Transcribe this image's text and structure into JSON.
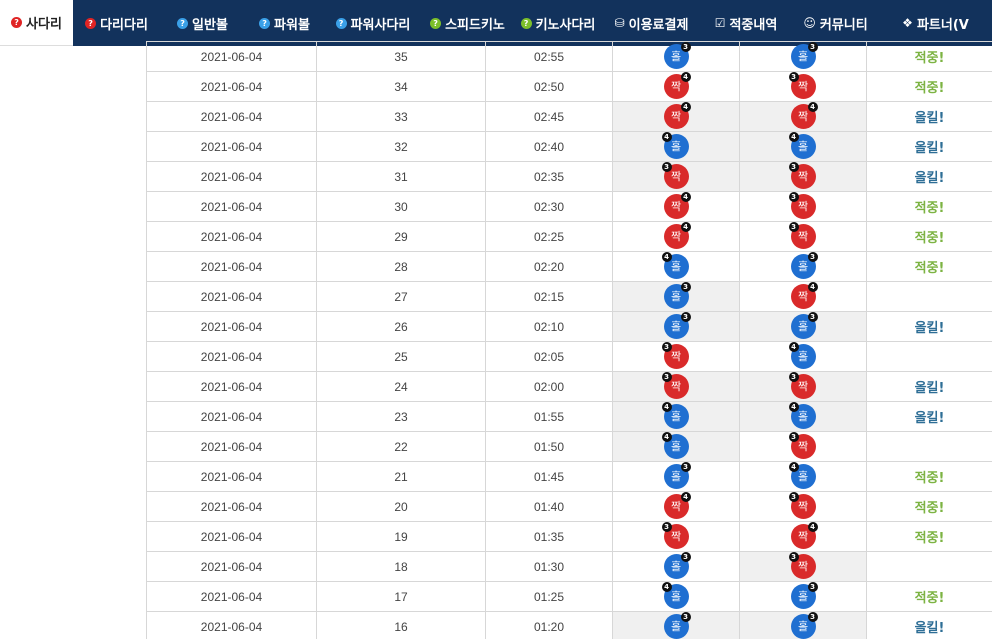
{
  "nav": {
    "tabs": [
      {
        "label": "사다리",
        "icon": "question-icon",
        "icon_color": "red",
        "active": true
      },
      {
        "label": "다리다리",
        "icon": "question-icon",
        "icon_color": "red",
        "active": false
      },
      {
        "label": "일반볼",
        "icon": "question-icon",
        "icon_color": "blue",
        "active": false
      },
      {
        "label": "파워볼",
        "icon": "question-icon",
        "icon_color": "blue",
        "active": false
      },
      {
        "label": "파워사다리",
        "icon": "question-icon",
        "icon_color": "blue",
        "active": false
      },
      {
        "label": "스피드키노",
        "icon": "question-icon",
        "icon_color": "green",
        "active": false
      },
      {
        "label": "키노사다리",
        "icon": "question-icon",
        "icon_color": "green",
        "active": false
      },
      {
        "label": "이용료결제",
        "icon": "database-icon",
        "icon_color": "white",
        "active": false
      },
      {
        "label": "적중내역",
        "icon": "checkbox-icon",
        "icon_color": "white",
        "active": false
      },
      {
        "label": "커뮤니티",
        "icon": "smile-icon",
        "icon_color": "white",
        "active": false
      },
      {
        "label": "파트너(V",
        "icon": "cubes-icon",
        "icon_color": "white",
        "active": false
      }
    ],
    "colors": {
      "bar": "#12325c",
      "active_bg": "#ffffff"
    }
  },
  "results": {
    "labels": {
      "hit": "적중!",
      "allkill": "올킬!"
    },
    "ball_colors": {
      "odd": "#1f6fd1",
      "even": "#d92a2a"
    },
    "rows": [
      {
        "date": "2021-06-04",
        "round": "35",
        "time": "02:55",
        "pick1": {
          "text": "홀",
          "type": "odd",
          "badge": "3",
          "side": "right"
        },
        "pick1_shade": false,
        "pick2": {
          "text": "홀",
          "type": "odd",
          "badge": "3",
          "side": "right"
        },
        "pick2_shade": false,
        "result": "적중!",
        "result_type": "hit"
      },
      {
        "date": "2021-06-04",
        "round": "34",
        "time": "02:50",
        "pick1": {
          "text": "짝",
          "type": "even",
          "badge": "4",
          "side": "right"
        },
        "pick1_shade": false,
        "pick2": {
          "text": "짝",
          "type": "even",
          "badge": "3",
          "side": "left"
        },
        "pick2_shade": false,
        "result": "적중!",
        "result_type": "hit"
      },
      {
        "date": "2021-06-04",
        "round": "33",
        "time": "02:45",
        "pick1": {
          "text": "짝",
          "type": "even",
          "badge": "4",
          "side": "right"
        },
        "pick1_shade": true,
        "pick2": {
          "text": "짝",
          "type": "even",
          "badge": "4",
          "side": "right"
        },
        "pick2_shade": true,
        "result": "올킬!",
        "result_type": "allkill"
      },
      {
        "date": "2021-06-04",
        "round": "32",
        "time": "02:40",
        "pick1": {
          "text": "홀",
          "type": "odd",
          "badge": "4",
          "side": "left"
        },
        "pick1_shade": true,
        "pick2": {
          "text": "홀",
          "type": "odd",
          "badge": "4",
          "side": "left"
        },
        "pick2_shade": true,
        "result": "올킬!",
        "result_type": "allkill"
      },
      {
        "date": "2021-06-04",
        "round": "31",
        "time": "02:35",
        "pick1": {
          "text": "짝",
          "type": "even",
          "badge": "3",
          "side": "left"
        },
        "pick1_shade": true,
        "pick2": {
          "text": "짝",
          "type": "even",
          "badge": "3",
          "side": "left"
        },
        "pick2_shade": true,
        "result": "올킬!",
        "result_type": "allkill"
      },
      {
        "date": "2021-06-04",
        "round": "30",
        "time": "02:30",
        "pick1": {
          "text": "짝",
          "type": "even",
          "badge": "4",
          "side": "right"
        },
        "pick1_shade": false,
        "pick2": {
          "text": "짝",
          "type": "even",
          "badge": "3",
          "side": "left"
        },
        "pick2_shade": false,
        "result": "적중!",
        "result_type": "hit"
      },
      {
        "date": "2021-06-04",
        "round": "29",
        "time": "02:25",
        "pick1": {
          "text": "짝",
          "type": "even",
          "badge": "4",
          "side": "right"
        },
        "pick1_shade": false,
        "pick2": {
          "text": "짝",
          "type": "even",
          "badge": "3",
          "side": "left"
        },
        "pick2_shade": false,
        "result": "적중!",
        "result_type": "hit"
      },
      {
        "date": "2021-06-04",
        "round": "28",
        "time": "02:20",
        "pick1": {
          "text": "홀",
          "type": "odd",
          "badge": "4",
          "side": "left"
        },
        "pick1_shade": false,
        "pick2": {
          "text": "홀",
          "type": "odd",
          "badge": "3",
          "side": "right"
        },
        "pick2_shade": false,
        "result": "적중!",
        "result_type": "hit"
      },
      {
        "date": "2021-06-04",
        "round": "27",
        "time": "02:15",
        "pick1": {
          "text": "홀",
          "type": "odd",
          "badge": "3",
          "side": "right"
        },
        "pick1_shade": true,
        "pick2": {
          "text": "짝",
          "type": "even",
          "badge": "4",
          "side": "right"
        },
        "pick2_shade": false,
        "result": "",
        "result_type": "none"
      },
      {
        "date": "2021-06-04",
        "round": "26",
        "time": "02:10",
        "pick1": {
          "text": "홀",
          "type": "odd",
          "badge": "3",
          "side": "right"
        },
        "pick1_shade": true,
        "pick2": {
          "text": "홀",
          "type": "odd",
          "badge": "3",
          "side": "right"
        },
        "pick2_shade": true,
        "result": "올킬!",
        "result_type": "allkill"
      },
      {
        "date": "2021-06-04",
        "round": "25",
        "time": "02:05",
        "pick1": {
          "text": "짝",
          "type": "even",
          "badge": "3",
          "side": "left"
        },
        "pick1_shade": false,
        "pick2": {
          "text": "홀",
          "type": "odd",
          "badge": "4",
          "side": "left"
        },
        "pick2_shade": false,
        "result": "",
        "result_type": "none"
      },
      {
        "date": "2021-06-04",
        "round": "24",
        "time": "02:00",
        "pick1": {
          "text": "짝",
          "type": "even",
          "badge": "3",
          "side": "left"
        },
        "pick1_shade": true,
        "pick2": {
          "text": "짝",
          "type": "even",
          "badge": "3",
          "side": "left"
        },
        "pick2_shade": true,
        "result": "올킬!",
        "result_type": "allkill"
      },
      {
        "date": "2021-06-04",
        "round": "23",
        "time": "01:55",
        "pick1": {
          "text": "홀",
          "type": "odd",
          "badge": "4",
          "side": "left"
        },
        "pick1_shade": true,
        "pick2": {
          "text": "홀",
          "type": "odd",
          "badge": "4",
          "side": "left"
        },
        "pick2_shade": true,
        "result": "올킬!",
        "result_type": "allkill"
      },
      {
        "date": "2021-06-04",
        "round": "22",
        "time": "01:50",
        "pick1": {
          "text": "홀",
          "type": "odd",
          "badge": "4",
          "side": "left"
        },
        "pick1_shade": true,
        "pick2": {
          "text": "짝",
          "type": "even",
          "badge": "3",
          "side": "left"
        },
        "pick2_shade": false,
        "result": "",
        "result_type": "none"
      },
      {
        "date": "2021-06-04",
        "round": "21",
        "time": "01:45",
        "pick1": {
          "text": "홀",
          "type": "odd",
          "badge": "3",
          "side": "right"
        },
        "pick1_shade": false,
        "pick2": {
          "text": "홀",
          "type": "odd",
          "badge": "4",
          "side": "left"
        },
        "pick2_shade": false,
        "result": "적중!",
        "result_type": "hit"
      },
      {
        "date": "2021-06-04",
        "round": "20",
        "time": "01:40",
        "pick1": {
          "text": "짝",
          "type": "even",
          "badge": "4",
          "side": "right"
        },
        "pick1_shade": false,
        "pick2": {
          "text": "짝",
          "type": "even",
          "badge": "3",
          "side": "left"
        },
        "pick2_shade": false,
        "result": "적중!",
        "result_type": "hit"
      },
      {
        "date": "2021-06-04",
        "round": "19",
        "time": "01:35",
        "pick1": {
          "text": "짝",
          "type": "even",
          "badge": "3",
          "side": "left"
        },
        "pick1_shade": false,
        "pick2": {
          "text": "짝",
          "type": "even",
          "badge": "4",
          "side": "right"
        },
        "pick2_shade": false,
        "result": "적중!",
        "result_type": "hit"
      },
      {
        "date": "2021-06-04",
        "round": "18",
        "time": "01:30",
        "pick1": {
          "text": "홀",
          "type": "odd",
          "badge": "3",
          "side": "right"
        },
        "pick1_shade": false,
        "pick2": {
          "text": "짝",
          "type": "even",
          "badge": "3",
          "side": "left"
        },
        "pick2_shade": true,
        "result": "",
        "result_type": "none"
      },
      {
        "date": "2021-06-04",
        "round": "17",
        "time": "01:25",
        "pick1": {
          "text": "홀",
          "type": "odd",
          "badge": "4",
          "side": "left"
        },
        "pick1_shade": false,
        "pick2": {
          "text": "홀",
          "type": "odd",
          "badge": "3",
          "side": "right"
        },
        "pick2_shade": false,
        "result": "적중!",
        "result_type": "hit"
      },
      {
        "date": "2021-06-04",
        "round": "16",
        "time": "01:20",
        "pick1": {
          "text": "홀",
          "type": "odd",
          "badge": "3",
          "side": "right"
        },
        "pick1_shade": true,
        "pick2": {
          "text": "홀",
          "type": "odd",
          "badge": "3",
          "side": "right"
        },
        "pick2_shade": true,
        "result": "올킬!",
        "result_type": "allkill"
      }
    ]
  }
}
